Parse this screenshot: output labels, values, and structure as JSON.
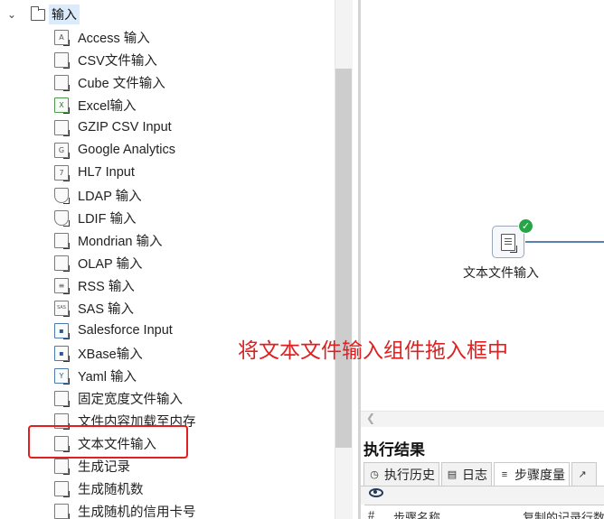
{
  "tree": {
    "root_label": "输入",
    "items": [
      {
        "label": "Access 输入",
        "icon": "access-icon",
        "glyph": "A"
      },
      {
        "label": "CSV文件输入",
        "icon": "csv-file-icon",
        "glyph": ""
      },
      {
        "label": "Cube 文件输入",
        "icon": "cube-file-icon",
        "glyph": ""
      },
      {
        "label": "Excel输入",
        "icon": "excel-icon",
        "glyph": "X"
      },
      {
        "label": "GZIP CSV Input",
        "icon": "gzip-file-icon",
        "glyph": ""
      },
      {
        "label": "Google Analytics",
        "icon": "google-analytics-icon",
        "glyph": "G"
      },
      {
        "label": "HL7 Input",
        "icon": "hl7-icon",
        "glyph": "7"
      },
      {
        "label": "LDAP 输入",
        "icon": "ldap-shield-icon",
        "glyph": ""
      },
      {
        "label": "LDIF 输入",
        "icon": "ldif-shield-icon",
        "glyph": ""
      },
      {
        "label": "Mondrian 输入",
        "icon": "mondrian-icon",
        "glyph": ""
      },
      {
        "label": "OLAP 输入",
        "icon": "olap-icon",
        "glyph": ""
      },
      {
        "label": "RSS 输入",
        "icon": "rss-icon",
        "glyph": "≡"
      },
      {
        "label": "SAS 输入",
        "icon": "sas-icon",
        "glyph": "SAS"
      },
      {
        "label": "Salesforce Input",
        "icon": "salesforce-icon",
        "glyph": "▪"
      },
      {
        "label": "XBase输入",
        "icon": "xbase-icon",
        "glyph": "▪"
      },
      {
        "label": "Yaml 输入",
        "icon": "yaml-icon",
        "glyph": "Y"
      },
      {
        "label": "固定宽度文件输入",
        "icon": "fixed-width-file-icon",
        "glyph": ""
      },
      {
        "label": "文件内容加载至内存",
        "icon": "load-file-memory-icon",
        "glyph": ""
      },
      {
        "label": "文本文件输入",
        "icon": "text-file-input-icon",
        "glyph": ""
      },
      {
        "label": "生成记录",
        "icon": "generate-rows-icon",
        "glyph": ""
      },
      {
        "label": "生成随机数",
        "icon": "random-number-icon",
        "glyph": ""
      },
      {
        "label": "生成随机的信用卡号",
        "icon": "random-credit-card-icon",
        "glyph": ""
      }
    ]
  },
  "canvas": {
    "step_label": "文本文件输入",
    "step_status_icon": "check-icon",
    "instruction": "将文本文件输入组件拖入框中"
  },
  "results": {
    "title": "执行结果",
    "tabs": [
      {
        "label": "执行历史",
        "icon": "clock-icon"
      },
      {
        "label": "日志",
        "icon": "log-icon"
      },
      {
        "label": "步骤度量",
        "icon": "metrics-icon"
      }
    ],
    "table_headers": [
      "#",
      "步骤名称",
      "复制的记录行数"
    ]
  },
  "colors": {
    "highlight": "#e02020",
    "success": "#25a545",
    "selection": "#dcebfb"
  }
}
